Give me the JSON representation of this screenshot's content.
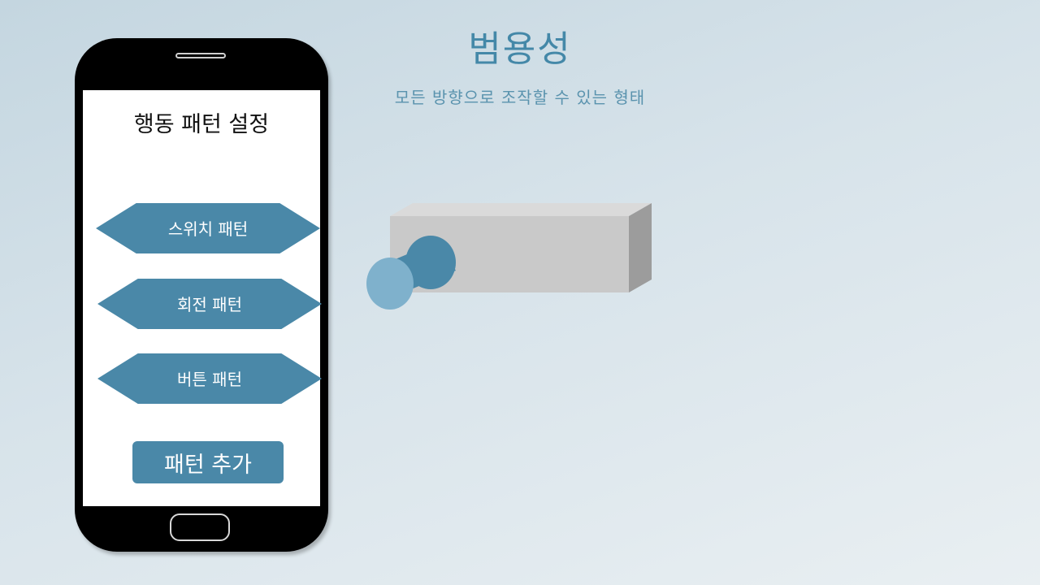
{
  "header": {
    "title": "범용성",
    "subtitle": "모든 방향으로 조작할 수 있는 형태"
  },
  "phone": {
    "screen_title": "행동 패턴 설정",
    "patterns": [
      {
        "label": "스위치 패턴"
      },
      {
        "label": "회전 패턴"
      },
      {
        "label": "버튼 패턴"
      }
    ],
    "add_button_label": "패턴 추가"
  },
  "colors": {
    "accent": "#4a88a8",
    "title": "#4488a8",
    "box_front": "#c9c9c9",
    "box_top": "#dadada",
    "box_side": "#9c9c9c"
  }
}
